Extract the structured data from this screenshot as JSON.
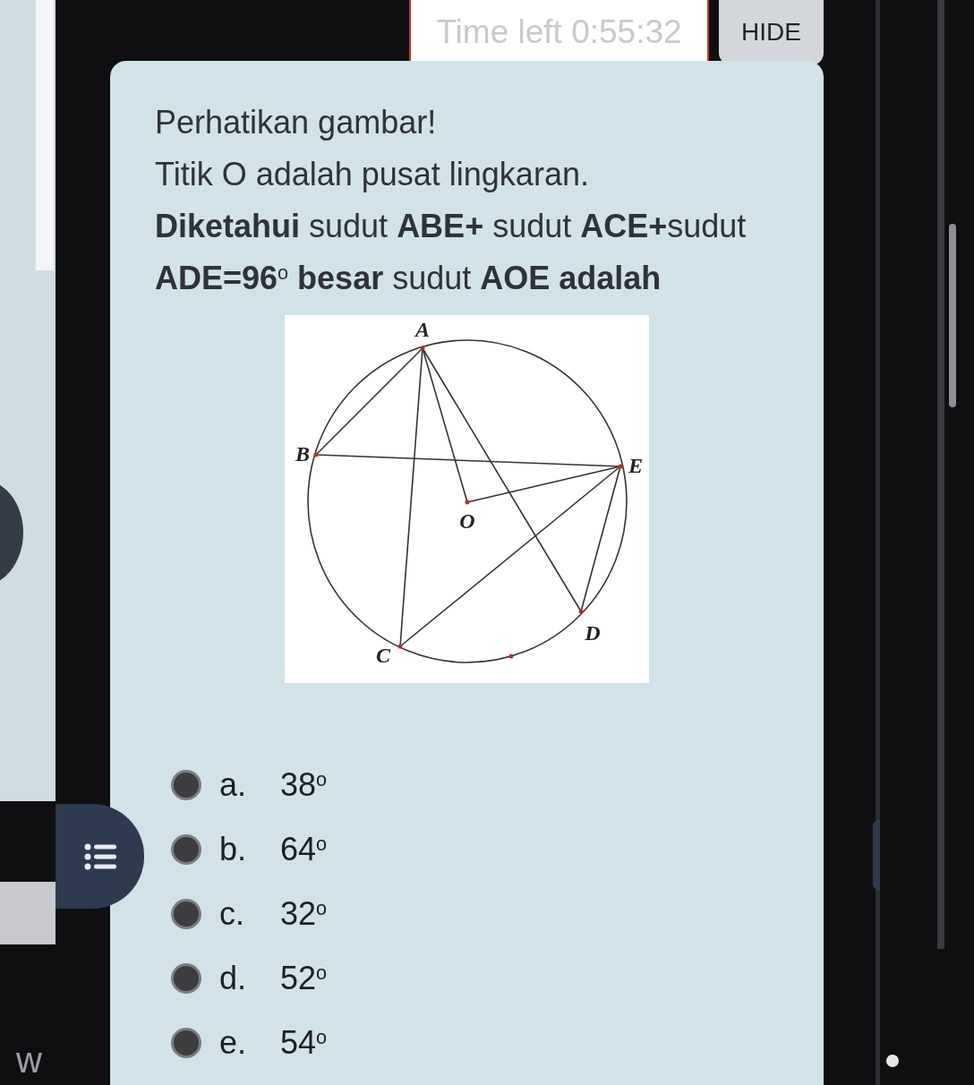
{
  "background": {
    "texts": [
      "w"
    ]
  },
  "timer": {
    "text": "Time left 0:55:32"
  },
  "hide_button": {
    "label": "HIDE"
  },
  "question": {
    "lines": [
      "Perhatikan gambar!",
      "Titik O adalah pusat lingkaran.",
      "**Diketahui** sudut **ABE+** sudut **ACE+**sudut",
      "**ADE=96**$^{o}$ **besar** sudut **AOE adalah**"
    ]
  },
  "figure": {
    "points": [
      {
        "label": "A"
      },
      {
        "label": "B"
      },
      {
        "label": "E"
      },
      {
        "label": "O"
      },
      {
        "label": "D"
      },
      {
        "label": "C"
      }
    ]
  },
  "options": [
    {
      "letter": "a.",
      "value": "38$^{o}$",
      "selected": false
    },
    {
      "letter": "b.",
      "value": "64$^{o}$",
      "selected": false
    },
    {
      "letter": "c.",
      "value": "32$^{o}$",
      "selected": false
    },
    {
      "letter": "d.",
      "value": "52$^{o}$",
      "selected": false
    },
    {
      "letter": "e.",
      "value": "54$^{o}$",
      "selected": false
    }
  ]
}
